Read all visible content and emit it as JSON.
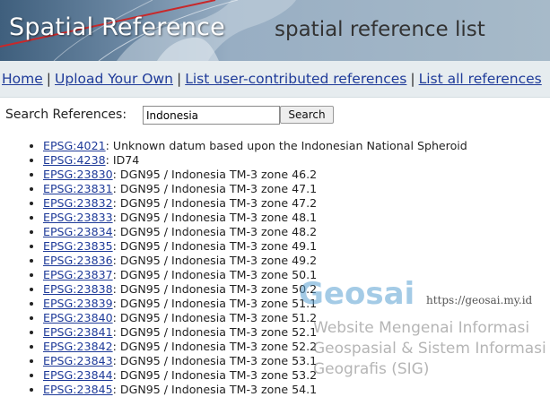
{
  "banner": {
    "title": "Spatial Reference",
    "subtitle": "spatial reference list"
  },
  "nav": {
    "items": [
      {
        "label": "Home"
      },
      {
        "label": "Upload Your Own"
      },
      {
        "label": "List user-contributed references"
      },
      {
        "label": "List all references"
      }
    ],
    "separator": "|"
  },
  "search": {
    "label": "Search References:",
    "value": "Indonesia",
    "button": "Search"
  },
  "results": [
    {
      "code": "EPSG:4021",
      "name": "Unknown datum based upon the Indonesian National Spheroid"
    },
    {
      "code": "EPSG:4238",
      "name": "ID74"
    },
    {
      "code": "EPSG:23830",
      "name": "DGN95 / Indonesia TM-3 zone 46.2"
    },
    {
      "code": "EPSG:23831",
      "name": "DGN95 / Indonesia TM-3 zone 47.1"
    },
    {
      "code": "EPSG:23832",
      "name": "DGN95 / Indonesia TM-3 zone 47.2"
    },
    {
      "code": "EPSG:23833",
      "name": "DGN95 / Indonesia TM-3 zone 48.1"
    },
    {
      "code": "EPSG:23834",
      "name": "DGN95 / Indonesia TM-3 zone 48.2"
    },
    {
      "code": "EPSG:23835",
      "name": "DGN95 / Indonesia TM-3 zone 49.1"
    },
    {
      "code": "EPSG:23836",
      "name": "DGN95 / Indonesia TM-3 zone 49.2"
    },
    {
      "code": "EPSG:23837",
      "name": "DGN95 / Indonesia TM-3 zone 50.1"
    },
    {
      "code": "EPSG:23838",
      "name": "DGN95 / Indonesia TM-3 zone 50.2"
    },
    {
      "code": "EPSG:23839",
      "name": "DGN95 / Indonesia TM-3 zone 51.1"
    },
    {
      "code": "EPSG:23840",
      "name": "DGN95 / Indonesia TM-3 zone 51.2"
    },
    {
      "code": "EPSG:23841",
      "name": "DGN95 / Indonesia TM-3 zone 52.1"
    },
    {
      "code": "EPSG:23842",
      "name": "DGN95 / Indonesia TM-3 zone 52.2"
    },
    {
      "code": "EPSG:23843",
      "name": "DGN95 / Indonesia TM-3 zone 53.1"
    },
    {
      "code": "EPSG:23844",
      "name": "DGN95 / Indonesia TM-3 zone 53.2"
    },
    {
      "code": "EPSG:23845",
      "name": "DGN95 / Indonesia TM-3 zone 54.1"
    }
  ],
  "watermark": {
    "logo": "Geosai",
    "url": "https://geosai.my.id",
    "lines": [
      "Website Mengenai Informasi",
      "Geospasial & Sistem Informasi",
      "Geografis (SIG)"
    ]
  }
}
